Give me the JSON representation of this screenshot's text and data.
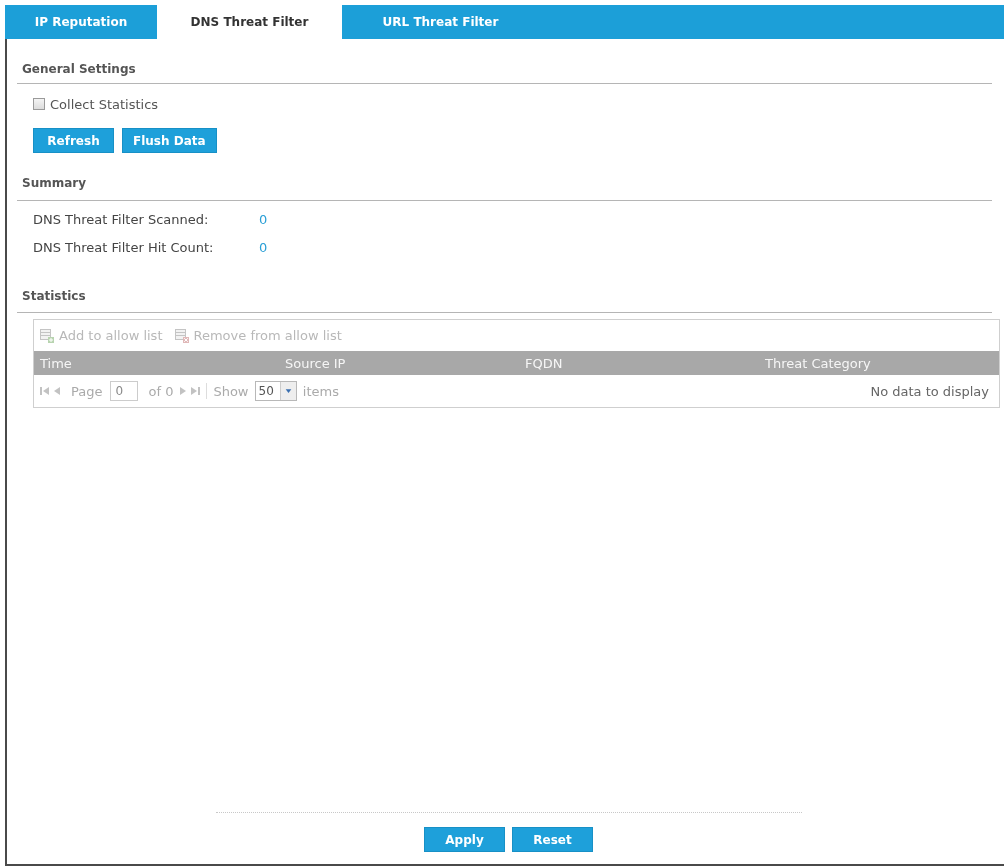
{
  "tabs": [
    {
      "label": "IP Reputation",
      "selected": false
    },
    {
      "label": "DNS Threat Filter",
      "selected": true
    },
    {
      "label": "URL Threat Filter",
      "selected": false
    }
  ],
  "general_settings": {
    "heading": "General Settings",
    "checkbox": {
      "label": "Collect Statistics",
      "checked": false
    },
    "buttons": [
      "Refresh",
      "Flush Data"
    ]
  },
  "summary": {
    "heading": "Summary",
    "rows": [
      {
        "label": "DNS Threat Filter Scanned:",
        "value": "0"
      },
      {
        "label": "DNS Threat Filter Hit Count:",
        "value": "0"
      }
    ]
  },
  "statistics": {
    "heading": "Statistics",
    "toolbar": [
      {
        "label": "Add to allow list",
        "kind": "add",
        "disabled": true
      },
      {
        "label": "Remove from allow list",
        "kind": "remove",
        "disabled": true
      }
    ],
    "table": {
      "columns": [
        "Time",
        "Source IP",
        "FQDN",
        "Threat Category"
      ]
    },
    "pager": {
      "disabled": true,
      "page_label": "Page",
      "page_value": "0",
      "of_label": "of 0",
      "show_label": "Show",
      "page_size": "50",
      "items_label": "items",
      "empty_message": "No data to display"
    }
  },
  "buttons": [
    "Apply",
    "Reset"
  ]
}
